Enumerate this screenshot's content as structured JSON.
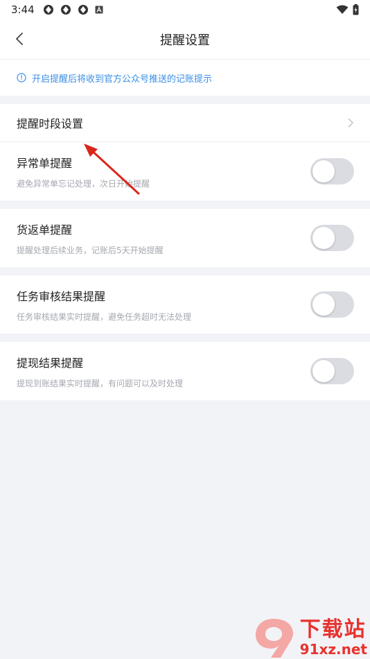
{
  "status_bar": {
    "time": "3:44"
  },
  "nav": {
    "title": "提醒设置"
  },
  "notice": {
    "text": "开启提醒后将收到官方公众号推送的记账提示"
  },
  "period_setting": {
    "label": "提醒时段设置"
  },
  "settings": [
    {
      "title": "异常单提醒",
      "desc": "避免异常单忘记处理，次日开始提醒",
      "enabled": false
    },
    {
      "title": "货返单提醒",
      "desc": "提醒处理后续业务，记账后5天开始提醒",
      "enabled": false
    },
    {
      "title": "任务审核结果提醒",
      "desc": "任务审核结果实时提醒，避免任务超时无法处理",
      "enabled": false
    },
    {
      "title": "提现结果提醒",
      "desc": "提现到账结果实时提醒，有问题可以及时处理",
      "enabled": false
    }
  ],
  "watermark": {
    "cn": "下载站",
    "domain": "91xz.net"
  },
  "colors": {
    "accent": "#3a8ee6",
    "toggle_off": "#dadce2",
    "annotation_arrow": "#d9261c",
    "watermark": "#e8322e"
  },
  "icons": {
    "back": "chevron-left-icon",
    "info": "info-circle-icon",
    "chevron": "chevron-right-icon"
  }
}
